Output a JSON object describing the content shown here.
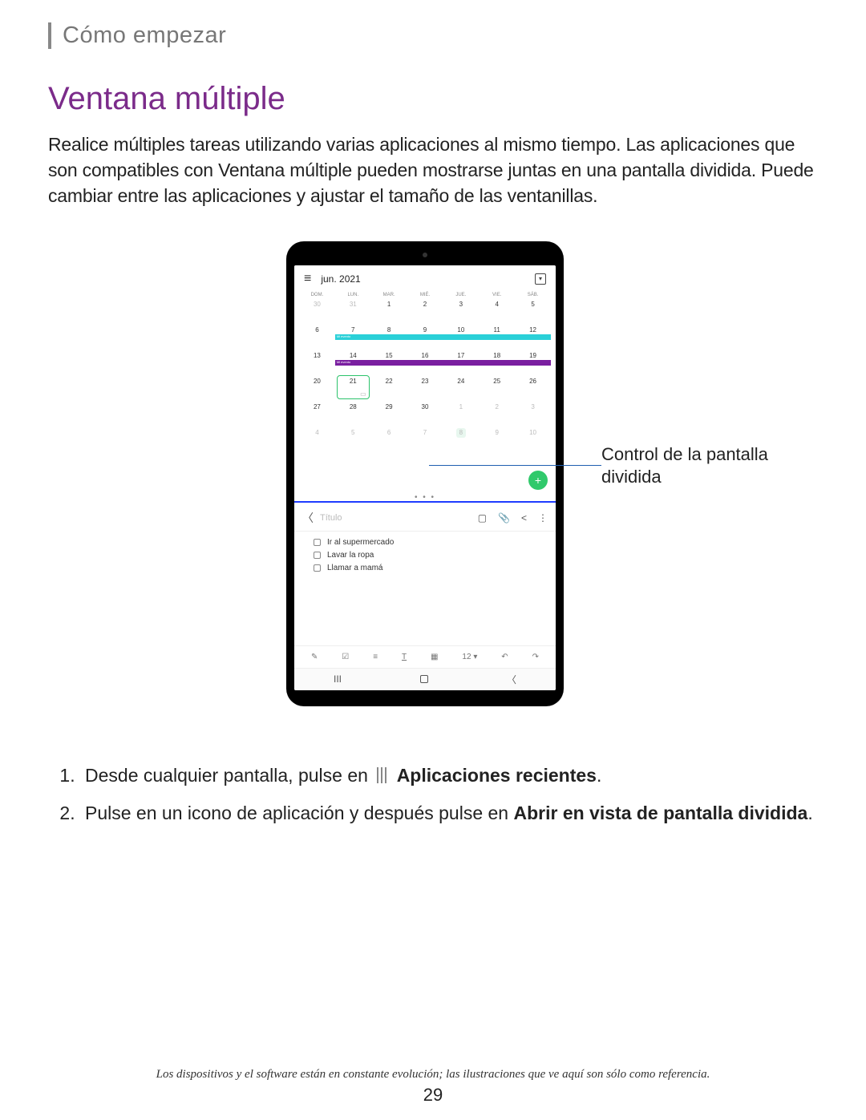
{
  "chapter": "Cómo empezar",
  "title": "Ventana múltiple",
  "intro": "Realice múltiples tareas utilizando varias aplicaciones al mismo tiempo. Las aplicaciones que son compatibles con Ventana múltiple pueden mostrarse juntas en una pantalla dividida. Puede cambiar entre las aplicaciones y ajustar el tamaño de las ventanillas.",
  "callout": "Control de la pantalla dividida",
  "calendar": {
    "month": "jun. 2021",
    "dow": [
      "DOM.",
      "LUN.",
      "MAR.",
      "MIÉ.",
      "JUE.",
      "VIE.",
      "SÁB."
    ],
    "weeks": [
      [
        {
          "n": "30",
          "dim": true
        },
        {
          "n": "31",
          "dim": true
        },
        {
          "n": "1"
        },
        {
          "n": "2"
        },
        {
          "n": "3"
        },
        {
          "n": "4"
        },
        {
          "n": "5"
        }
      ],
      [
        {
          "n": "6"
        },
        {
          "n": "7",
          "evt": "cyan",
          "tag": "Mi evento"
        },
        {
          "n": "8",
          "evt": "cyan"
        },
        {
          "n": "9",
          "evt": "cyan"
        },
        {
          "n": "10",
          "evt": "cyan"
        },
        {
          "n": "11",
          "evt": "cyan"
        },
        {
          "n": "12",
          "evt": "cyan"
        }
      ],
      [
        {
          "n": "13"
        },
        {
          "n": "14",
          "evt": "purple",
          "tag": "Mi evento"
        },
        {
          "n": "15",
          "evt": "purple"
        },
        {
          "n": "16",
          "evt": "purple"
        },
        {
          "n": "17",
          "evt": "purple"
        },
        {
          "n": "18",
          "evt": "purple"
        },
        {
          "n": "19",
          "evt": "purple"
        }
      ],
      [
        {
          "n": "20"
        },
        {
          "n": "21",
          "today": true,
          "note": true
        },
        {
          "n": "22"
        },
        {
          "n": "23"
        },
        {
          "n": "24"
        },
        {
          "n": "25"
        },
        {
          "n": "26"
        }
      ],
      [
        {
          "n": "27"
        },
        {
          "n": "28"
        },
        {
          "n": "29"
        },
        {
          "n": "30"
        },
        {
          "n": "1",
          "dim": true
        },
        {
          "n": "2",
          "dim": true
        },
        {
          "n": "3",
          "dim": true
        }
      ],
      [
        {
          "n": "4",
          "dim": true
        },
        {
          "n": "5",
          "dim": true
        },
        {
          "n": "6",
          "dim": true
        },
        {
          "n": "7",
          "dim": true
        },
        {
          "n": "8",
          "dim": true,
          "sel": true
        },
        {
          "n": "9",
          "dim": true
        },
        {
          "n": "10",
          "dim": true
        }
      ]
    ]
  },
  "notes": {
    "title_placeholder": "Título",
    "items": [
      "Ir al supermercado",
      "Lavar la ropa",
      "Llamar a mamá"
    ],
    "tool_text": "12 ▾"
  },
  "steps": {
    "s1a": "Desde cualquier pantalla, pulse en",
    "s1b": "Aplicaciones recientes",
    "s2a": "Pulse en un icono de aplicación y después pulse en ",
    "s2b": "Abrir en vista de pantalla dividida"
  },
  "disclaimer": "Los dispositivos y el software están en constante evolución; las ilustraciones que ve aquí son sólo como referencia.",
  "pagenum": "29"
}
